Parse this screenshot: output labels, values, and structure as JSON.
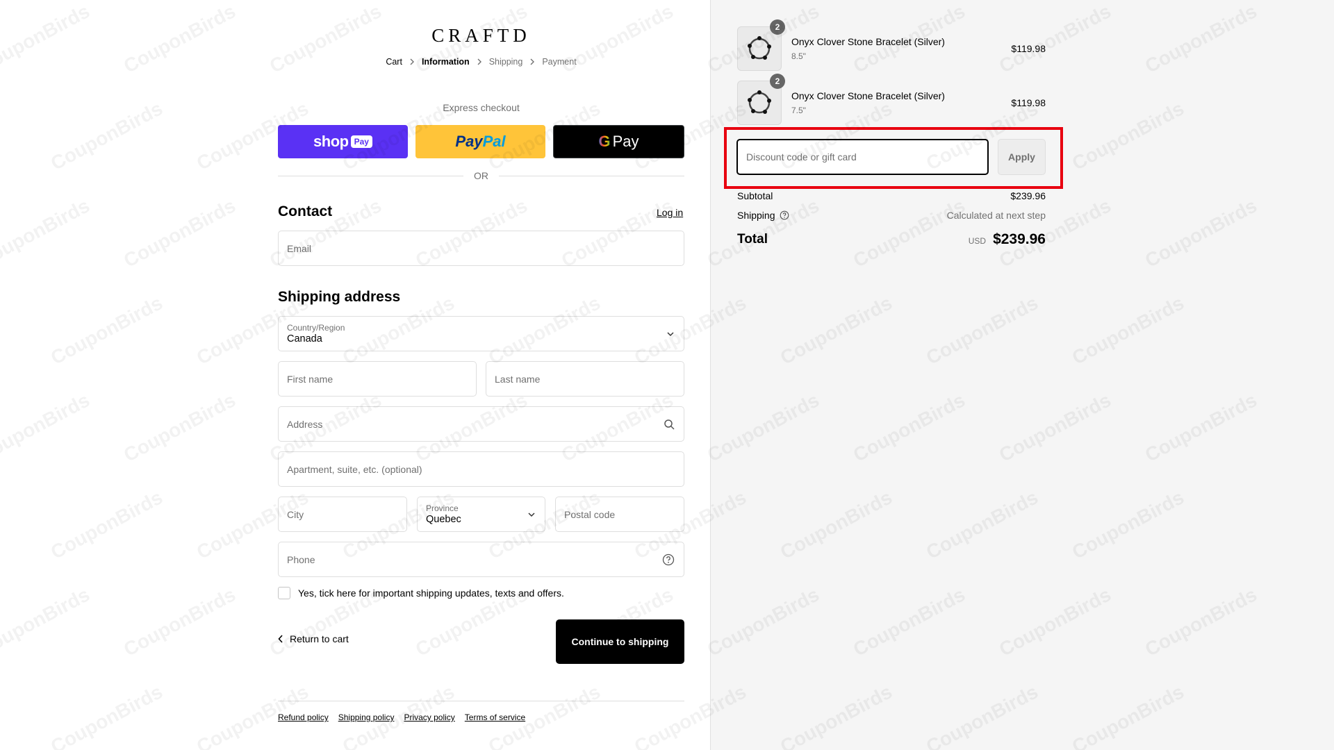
{
  "brand": {
    "logo_text": "CRAFTD"
  },
  "breadcrumb": [
    {
      "label": "Cart",
      "state": "link"
    },
    {
      "label": "Information",
      "state": "active"
    },
    {
      "label": "Shipping",
      "state": "inactive"
    },
    {
      "label": "Payment",
      "state": "inactive"
    }
  ],
  "express": {
    "label": "Express checkout",
    "shop_word": "shop",
    "shop_pay": "Pay",
    "paypal_part1": "Pay",
    "paypal_part2": "Pal",
    "gpay_g": "G",
    "gpay_word": "Pay"
  },
  "or_text": "OR",
  "contact": {
    "title": "Contact",
    "login": "Log in",
    "email_placeholder": "Email"
  },
  "shipping": {
    "title": "Shipping address",
    "country_label": "Country/Region",
    "country_value": "Canada",
    "first_name": "First name",
    "last_name": "Last name",
    "address": "Address",
    "apartment": "Apartment, suite, etc. (optional)",
    "city": "City",
    "province_label": "Province",
    "province_value": "Quebec",
    "postal": "Postal code",
    "phone": "Phone",
    "marketing_opt_in": "Yes, tick here for important shipping updates, texts and offers."
  },
  "actions": {
    "return": "Return to cart",
    "continue": "Continue to shipping"
  },
  "footer": {
    "links": [
      "Refund policy",
      "Shipping policy",
      "Privacy policy",
      "Terms of service"
    ]
  },
  "cart": {
    "items": [
      {
        "name": "Onyx Clover Stone Bracelet (Silver)",
        "variant": "8.5\"",
        "price": "$119.98",
        "qty": "2"
      },
      {
        "name": "Onyx Clover Stone Bracelet (Silver)",
        "variant": "7.5\"",
        "price": "$119.98",
        "qty": "2"
      }
    ],
    "discount_placeholder": "Discount code or gift card",
    "apply": "Apply",
    "subtotal_label": "Subtotal",
    "subtotal_value": "$239.96",
    "shipping_label": "Shipping",
    "shipping_value": "Calculated at next step",
    "total_label": "Total",
    "total_currency": "USD",
    "total_value": "$239.96"
  },
  "watermark": "CouponBirds",
  "colors": {
    "shop_pay": "#5a31f4",
    "paypal": "#ffc439",
    "highlight": "#e8000f",
    "summary_bg": "#f5f5f5"
  }
}
